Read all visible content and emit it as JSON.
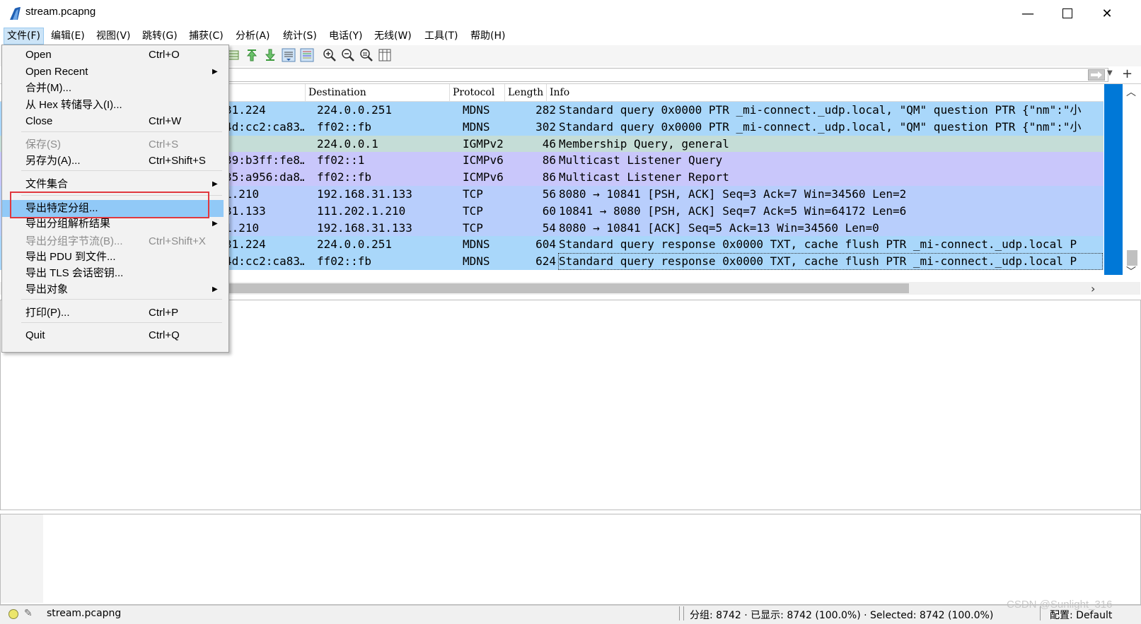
{
  "window": {
    "title": "stream.pcapng"
  },
  "menubar": [
    {
      "label": "文件(F)",
      "active": true
    },
    {
      "label": "编辑(E)"
    },
    {
      "label": "视图(V)"
    },
    {
      "label": "跳转(G)"
    },
    {
      "label": "捕获(C)"
    },
    {
      "label": "分析(A)"
    },
    {
      "label": "统计(S)"
    },
    {
      "label": "电话(Y)"
    },
    {
      "label": "无线(W)"
    },
    {
      "label": "工具(T)"
    },
    {
      "label": "帮助(H)"
    }
  ],
  "columns": {
    "destination": "Destination",
    "protocol": "Protocol",
    "length": "Length",
    "info": "Info"
  },
  "packets": [
    {
      "src": "31.224",
      "dst": "224.0.0.251",
      "proto": "MDNS",
      "len": "282",
      "info": "Standard query 0x0000 PTR _mi-connect._udp.local, \"QM\" question PTR {\"nm\":\"小",
      "color": "#a9d7fa"
    },
    {
      "src": "4d:cc2:ca83…",
      "dst": "ff02::fb",
      "proto": "MDNS",
      "len": "302",
      "info": "Standard query 0x0000 PTR _mi-connect._udp.local, \"QM\" question PTR {\"nm\":\"小",
      "color": "#a9d7fa"
    },
    {
      "src": "",
      "dst": "224.0.0.1",
      "proto": "IGMPv2",
      "len": "46",
      "info": "Membership Query, general",
      "color": "#c5ddd7"
    },
    {
      "src": "39:b3ff:fe8…",
      "dst": "ff02::1",
      "proto": "ICMPv6",
      "len": "86",
      "info": "Multicast Listener Query",
      "color": "#c9c7fb"
    },
    {
      "src": "35:a956:da8…",
      "dst": "ff02::fb",
      "proto": "ICMPv6",
      "len": "86",
      "info": "Multicast Listener Report",
      "color": "#c9c7fb"
    },
    {
      "src": "1.210",
      "dst": "192.168.31.133",
      "proto": "TCP",
      "len": "56",
      "info": "8080 → 10841 [PSH, ACK] Seq=3 Ack=7 Win=34560 Len=2",
      "color": "#b8cefc"
    },
    {
      "src": "31.133",
      "dst": "111.202.1.210",
      "proto": "TCP",
      "len": "60",
      "info": "10841 → 8080 [PSH, ACK] Seq=7 Ack=5 Win=64172 Len=6",
      "color": "#b8cefc"
    },
    {
      "src": "1.210",
      "dst": "192.168.31.133",
      "proto": "TCP",
      "len": "54",
      "info": "8080 → 10841 [ACK] Seq=5 Ack=13 Win=34560 Len=0",
      "color": "#b8cefc"
    },
    {
      "src": "31.224",
      "dst": "224.0.0.251",
      "proto": "MDNS",
      "len": "604",
      "info": "Standard query response 0x0000 TXT, cache flush PTR _mi-connect._udp.local P",
      "color": "#a9d7fa"
    },
    {
      "src": "4d:cc2:ca83…",
      "dst": "ff02::fb",
      "proto": "MDNS",
      "len": "624",
      "info": "Standard query response 0x0000 TXT, cache flush PTR _mi-connect._udp.local P",
      "color": "#a9d7fa"
    }
  ],
  "file_menu": {
    "items": [
      {
        "label": "Open",
        "shortcut": "Ctrl+O"
      },
      {
        "label": "Open Recent",
        "submenu": true
      },
      {
        "label": "合并(M)..."
      },
      {
        "label": "从 Hex 转储导入(I)..."
      },
      {
        "label": "Close",
        "shortcut": "Ctrl+W"
      },
      {
        "label": "保存(S)",
        "shortcut": "Ctrl+S",
        "disabled": true
      },
      {
        "label": "另存为(A)...",
        "shortcut": "Ctrl+Shift+S"
      },
      {
        "label": "文件集合",
        "submenu": true
      },
      {
        "label": "导出特定分组...",
        "highlight": true
      },
      {
        "label": "导出分组解析结果",
        "submenu": true
      },
      {
        "label": "导出分组字节流(B)...",
        "shortcut": "Ctrl+Shift+X",
        "disabled": true
      },
      {
        "label": "导出 PDU 到文件..."
      },
      {
        "label": "导出 TLS 会话密钥..."
      },
      {
        "label": "导出对象",
        "submenu": true
      },
      {
        "label": "打印(P)...",
        "shortcut": "Ctrl+P"
      },
      {
        "label": "Quit",
        "shortcut": "Ctrl+Q"
      }
    ]
  },
  "statusbar": {
    "file": "stream.pcapng",
    "stats": "分组: 8742 · 已显示: 8742 (100.0%) · Selected: 8742 (100.0%)",
    "profile": "配置: Default"
  },
  "watermark": "CSDN @Sunlight_316",
  "colors": {
    "highlight": "#91c9f7",
    "redbox": "#e0383e",
    "scroll_accent": "#0078d7"
  }
}
